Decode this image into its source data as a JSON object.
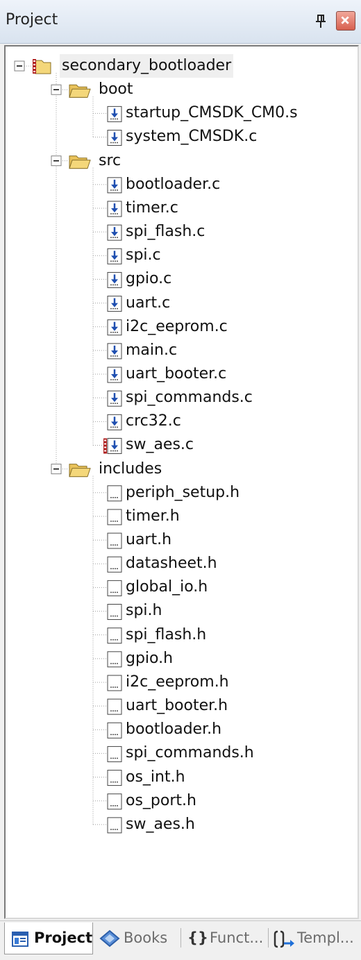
{
  "panel": {
    "title": "Project"
  },
  "tree": [
    {
      "label": "secondary_bootloader",
      "type": "project",
      "level": 0,
      "expanded": true,
      "selected": true
    },
    {
      "label": "boot",
      "type": "folder",
      "level": 1,
      "expanded": true
    },
    {
      "label": "startup_CMSDK_CM0.s",
      "type": "source",
      "level": 2
    },
    {
      "label": "system_CMSDK.c",
      "type": "source",
      "level": 2
    },
    {
      "label": "src",
      "type": "folder",
      "level": 1,
      "expanded": true
    },
    {
      "label": "bootloader.c",
      "type": "source",
      "level": 2
    },
    {
      "label": "timer.c",
      "type": "source",
      "level": 2
    },
    {
      "label": "spi_flash.c",
      "type": "source",
      "level": 2
    },
    {
      "label": "spi.c",
      "type": "source",
      "level": 2
    },
    {
      "label": "gpio.c",
      "type": "source",
      "level": 2
    },
    {
      "label": "uart.c",
      "type": "source",
      "level": 2
    },
    {
      "label": "i2c_eeprom.c",
      "type": "source",
      "level": 2
    },
    {
      "label": "main.c",
      "type": "source",
      "level": 2
    },
    {
      "label": "uart_booter.c",
      "type": "source",
      "level": 2
    },
    {
      "label": "spi_commands.c",
      "type": "source",
      "level": 2
    },
    {
      "label": "crc32.c",
      "type": "source",
      "level": 2
    },
    {
      "label": "sw_aes.c",
      "type": "source",
      "level": 2,
      "flagged": true
    },
    {
      "label": "includes",
      "type": "folder",
      "level": 1,
      "expanded": true
    },
    {
      "label": "periph_setup.h",
      "type": "header",
      "level": 2
    },
    {
      "label": "timer.h",
      "type": "header",
      "level": 2
    },
    {
      "label": "uart.h",
      "type": "header",
      "level": 2
    },
    {
      "label": "datasheet.h",
      "type": "header",
      "level": 2
    },
    {
      "label": "global_io.h",
      "type": "header",
      "level": 2
    },
    {
      "label": "spi.h",
      "type": "header",
      "level": 2
    },
    {
      "label": "spi_flash.h",
      "type": "header",
      "level": 2
    },
    {
      "label": "gpio.h",
      "type": "header",
      "level": 2
    },
    {
      "label": "i2c_eeprom.h",
      "type": "header",
      "level": 2
    },
    {
      "label": "uart_booter.h",
      "type": "header",
      "level": 2
    },
    {
      "label": "bootloader.h",
      "type": "header",
      "level": 2
    },
    {
      "label": "spi_commands.h",
      "type": "header",
      "level": 2
    },
    {
      "label": "os_int.h",
      "type": "header",
      "level": 2
    },
    {
      "label": "os_port.h",
      "type": "header",
      "level": 2
    },
    {
      "label": "sw_aes.h",
      "type": "header",
      "level": 2
    }
  ],
  "tabs": [
    {
      "label": "Project",
      "icon": "project-icon",
      "active": true
    },
    {
      "label": "Books",
      "icon": "books-icon",
      "active": false
    },
    {
      "label": "Funct...",
      "icon": "functions-icon",
      "active": false
    },
    {
      "label": "Templ...",
      "icon": "templates-icon",
      "active": false
    }
  ],
  "colors": {
    "folder": "#f4d77a",
    "source_icon": "#1f4fb0",
    "tree_line": "#a0a0a0",
    "selection": "#efefef"
  }
}
